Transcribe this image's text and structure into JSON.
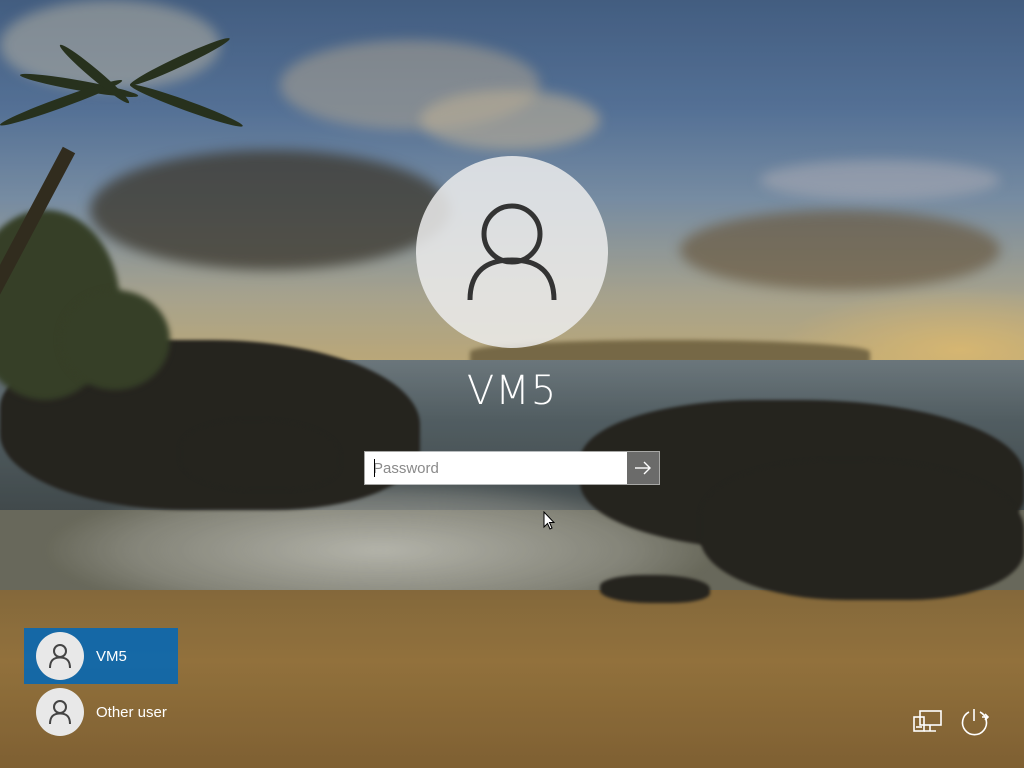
{
  "window": {
    "title": "Windows sign-in screen"
  },
  "account": {
    "name": "VM5",
    "avatar_icon": "person-icon"
  },
  "password": {
    "placeholder": "Password",
    "value": "",
    "submit_icon": "arrow-right-icon"
  },
  "user_list": [
    {
      "label": "VM5",
      "icon": "person-icon",
      "selected": true
    },
    {
      "label": "Other user",
      "icon": "person-icon",
      "selected": false
    }
  ],
  "system_icons": [
    {
      "name": "network-icon"
    },
    {
      "name": "ease-of-access-power-icon"
    }
  ],
  "colors": {
    "selected_tile": "#0067B8",
    "text": "#FFFFFF",
    "avatar_bg": "#E8E8E8"
  }
}
